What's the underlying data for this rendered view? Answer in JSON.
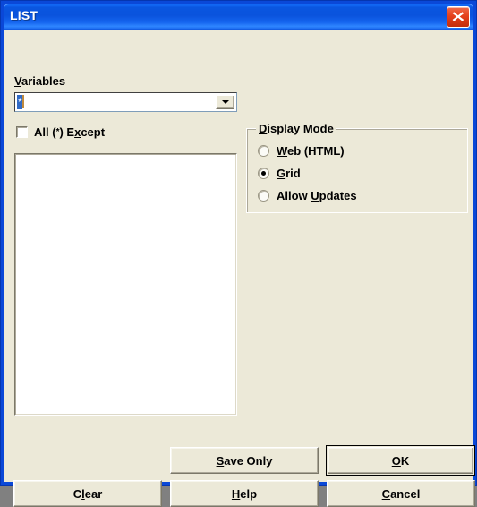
{
  "window": {
    "title": "LIST",
    "close_icon": "close-icon",
    "accent_titlebar": "#0a53dd",
    "client_bg": "#ece9d8"
  },
  "variables": {
    "label": "Variables",
    "label_accel": "V",
    "value": "*",
    "placeholder": "",
    "dropdown_icon": "chevron-down-icon"
  },
  "all_except": {
    "label_before": "All (",
    "label_star": "*",
    "label_mid": ") E",
    "label_accel": "x",
    "label_after": "cept",
    "checked": false
  },
  "list": {
    "items": []
  },
  "display_mode": {
    "title_accel": "D",
    "title_rest": "isplay Mode",
    "options": [
      {
        "pre": "",
        "accel": "W",
        "post": "eb (HTML)",
        "selected": false
      },
      {
        "pre": "",
        "accel": "G",
        "post": "rid",
        "selected": true
      },
      {
        "pre": "Allow ",
        "accel": "U",
        "post": "pdates",
        "selected": false
      }
    ]
  },
  "buttons": {
    "save_only": {
      "pre": "",
      "accel": "S",
      "post": "ave Only"
    },
    "ok": {
      "pre": "",
      "accel": "O",
      "post": "K",
      "default": true
    },
    "clear": {
      "pre": "C",
      "accel": "l",
      "post": "ear"
    },
    "help": {
      "pre": "",
      "accel": "H",
      "post": "elp"
    },
    "cancel": {
      "pre": "",
      "accel": "C",
      "post": "ancel"
    }
  }
}
